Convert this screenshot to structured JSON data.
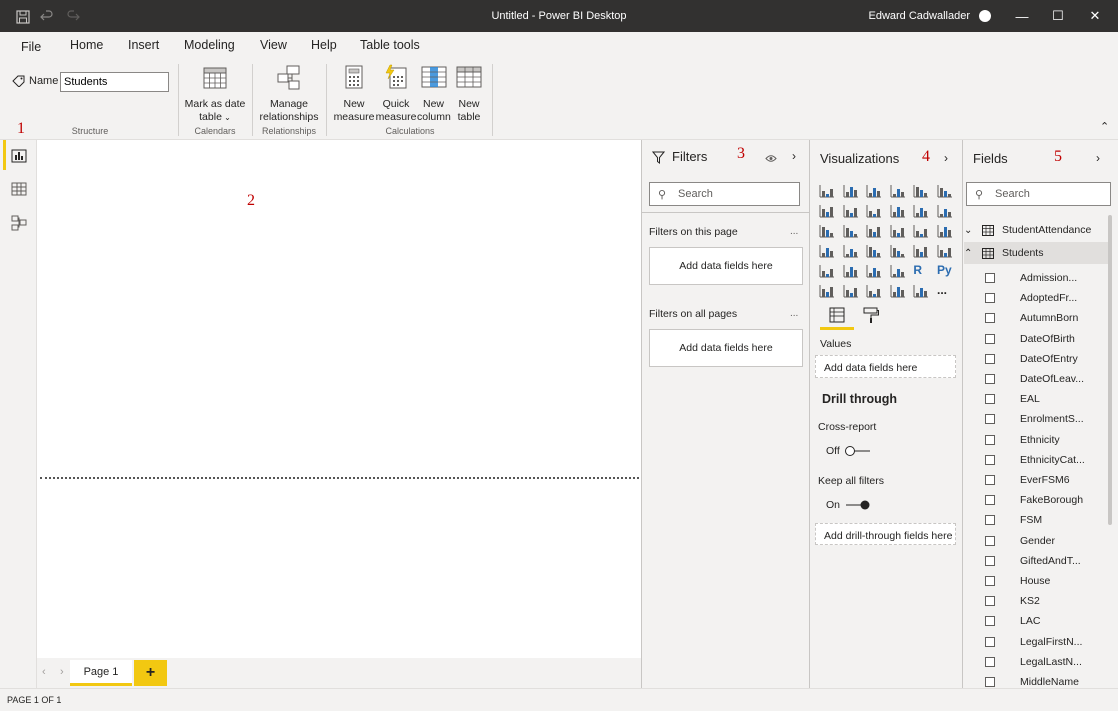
{
  "window": {
    "title": "Untitled - Power BI Desktop",
    "user": "Edward Cadwallader",
    "controls": {
      "minimize": "—",
      "maximize": "☐",
      "close": "✕"
    }
  },
  "ribbon": {
    "tabs": [
      {
        "label": "File"
      },
      {
        "label": "Home"
      },
      {
        "label": "Insert"
      },
      {
        "label": "Modeling"
      },
      {
        "label": "View"
      },
      {
        "label": "Help"
      },
      {
        "label": "Table tools",
        "active": true
      }
    ],
    "structure": {
      "name_label": "Name",
      "name_value": "Students",
      "group_label": "Structure"
    },
    "calendars": {
      "button_line1": "Mark as date",
      "button_line2": "table",
      "group_label": "Calendars"
    },
    "relationships": {
      "button_line1": "Manage",
      "button_line2": "relationships",
      "group_label": "Relationships"
    },
    "calculations": {
      "new_measure_line1": "New",
      "new_measure_line2": "measure",
      "quick_measure_line1": "Quick",
      "quick_measure_line2": "measure",
      "new_column_line1": "New",
      "new_column_line2": "column",
      "new_table_line1": "New",
      "new_table_line2": "table",
      "group_label": "Calculations"
    }
  },
  "annotations": {
    "n1": "1",
    "n2": "2",
    "n3": "3",
    "n4": "4",
    "n5": "5"
  },
  "pages": {
    "tab_label": "Page 1",
    "add_label": "+"
  },
  "status": {
    "text": "PAGE 1 OF 1"
  },
  "filters": {
    "title": "Filters",
    "search_placeholder": "Search",
    "on_this_page": "Filters on this page",
    "on_all_pages": "Filters on all pages",
    "dropzone": "Add data fields here",
    "more": "..."
  },
  "visualizations": {
    "title": "Visualizations",
    "values_label": "Values",
    "values_dropzone": "Add data fields here",
    "drill_title": "Drill through",
    "cross_report": "Cross-report",
    "cross_report_state": "Off",
    "keep_filters": "Keep all filters",
    "keep_filters_state": "On",
    "drill_dropzone": "Add drill-through fields here",
    "r_label": "R",
    "py_label": "Py",
    "more_label": "..."
  },
  "fields": {
    "title": "Fields",
    "search_placeholder": "Search",
    "tables": [
      {
        "name": "StudentAttendance",
        "expanded": false
      },
      {
        "name": "Students",
        "expanded": true
      }
    ],
    "columns": [
      "Admission...",
      "AdoptedFr...",
      "AutumnBorn",
      "DateOfBirth",
      "DateOfEntry",
      "DateOfLeav...",
      "EAL",
      "EnrolmentS...",
      "Ethnicity",
      "EthnicityCat...",
      "EverFSM6",
      "FakeBorough",
      "FSM",
      "Gender",
      "GiftedAndT...",
      "House",
      "KS2",
      "LAC",
      "LegalFirstN...",
      "LegalLastN...",
      "MiddleName"
    ]
  },
  "colors": {
    "accent": "#f2c811",
    "titlebar": "#323130",
    "pane_bg": "#f3f2f1",
    "annotation": "#c00000"
  }
}
